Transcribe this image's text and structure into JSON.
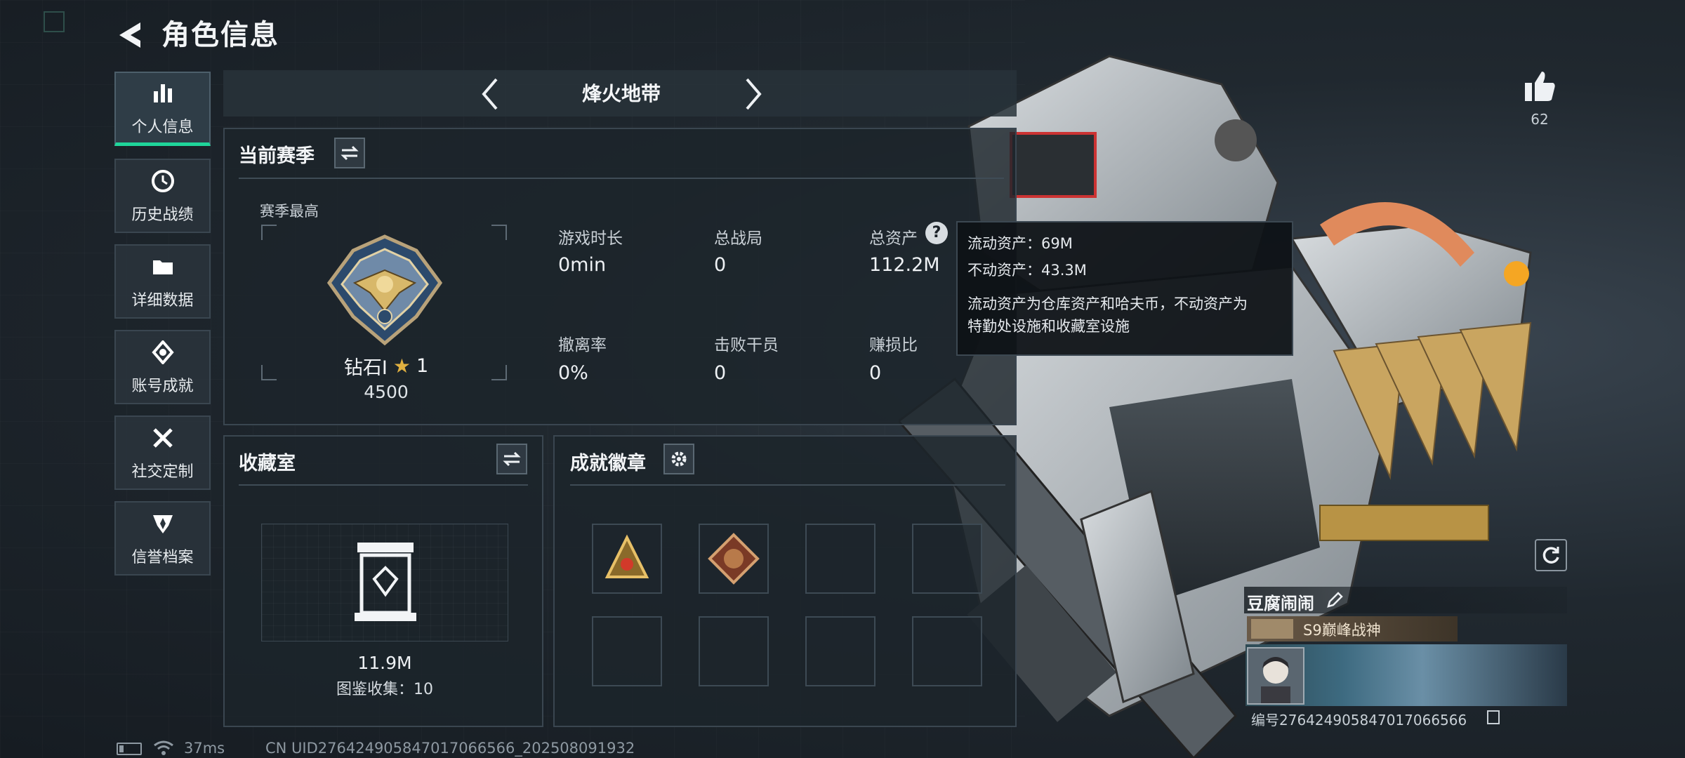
{
  "header": {
    "title": "角色信息"
  },
  "sidebar": {
    "items": [
      {
        "label": "个人信息",
        "icon": "bar-chart-icon",
        "active": true
      },
      {
        "label": "历史战绩",
        "icon": "clock-icon"
      },
      {
        "label": "详细数据",
        "icon": "folder-icon"
      },
      {
        "label": "账号成就",
        "icon": "achievement-icon"
      },
      {
        "label": "社交定制",
        "icon": "tools-icon"
      },
      {
        "label": "信誉档案",
        "icon": "shield-icon"
      }
    ]
  },
  "mode_tabs": {
    "current": "烽火地带"
  },
  "season": {
    "title": "当前赛季",
    "peak_label": "赛季最高",
    "rank_name": "钻石I",
    "rank_stars": "1",
    "rank_score": "4500",
    "stats": [
      {
        "label": "游戏时长",
        "value": "0min"
      },
      {
        "label": "总战局",
        "value": "0"
      },
      {
        "label": "总资产",
        "value": "112.2M"
      },
      {
        "label": "撤离率",
        "value": "0%"
      },
      {
        "label": "击败干员",
        "value": "0"
      },
      {
        "label": "赚损比",
        "value": "0"
      }
    ]
  },
  "tooltip": {
    "liquid": "流动资产：69M",
    "fixed": "不动资产：43.3M",
    "desc_line1": "流动资产为仓库资产和哈夫币，不动资产为",
    "desc_line2": "特勤处设施和收藏室设施"
  },
  "collection": {
    "title": "收藏室",
    "value": "11.9M",
    "count_text": "图鉴收集：10"
  },
  "achievements": {
    "title": "成就徽章"
  },
  "likes": {
    "count": "62"
  },
  "profile": {
    "name": "豆腐闹闹",
    "title_badge": "S9巅峰战神",
    "id_text": "编号276424905847017066566"
  },
  "status_bar": {
    "ping": "37ms",
    "uid_text": "CN UID276424905847017066566_202508091932"
  },
  "colors": {
    "accent": "#1fd59a",
    "rank_star": "#e0b040"
  }
}
